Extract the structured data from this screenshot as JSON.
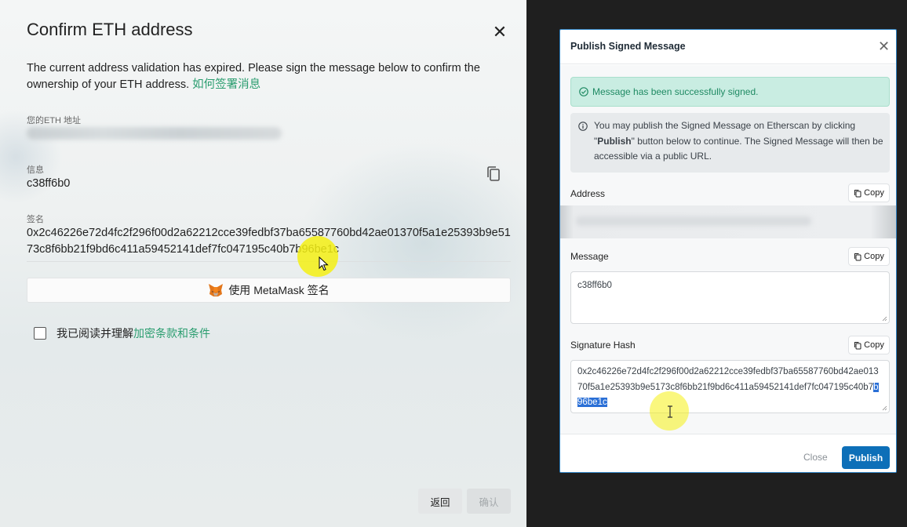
{
  "left_dialog": {
    "title": "Confirm ETH address",
    "close_symbol": "✕",
    "description": "The current address validation has expired. Please sign the message below to confirm the ownership of your ETH address.",
    "description_link": "如何签署消息",
    "address_label": "您的ETH 地址",
    "message_label": "信息",
    "message_value": "c38ff6b0",
    "signature_label": "签名",
    "signature_value": "0x2c46226e72d4fc2f296f00d2a62212cce39fedbf37ba65587760bd42ae01370f5a1e25393b9e5173c8f6bb21f9bd6c411a59452141def7fc047195c40b7b96be1c",
    "metamask_button": "使用 MetaMask 签名",
    "terms_prefix": "我已阅读并理解",
    "terms_link": "加密条款和条件",
    "back_button": "返回",
    "confirm_button": "确认"
  },
  "right_dialog": {
    "title": "Publish Signed Message",
    "close_symbol": "✕",
    "success_text": "Message has been successfully signed.",
    "info_pre": "You may publish the Signed Message on Etherscan by clicking \"",
    "info_bold": "Publish",
    "info_post": "\" button below to continue. The Signed Message will then be accessible via a public URL.",
    "address_label": "Address",
    "message_label": "Message",
    "message_value": "c38ff6b0",
    "signature_label": "Signature Hash",
    "signature_main": "0x2c46226e72d4fc2f296f00d2a62212cce39fedbf37ba65587760bd42ae01370f5a1e25393b9e5173c8f6bb21f9bd6c411a59452141def7fc047195c40b7",
    "signature_selected": "b96be1c",
    "copy_label": "Copy",
    "close_button": "Close",
    "publish_button": "Publish"
  },
  "colors": {
    "accent_green": "#2a9d6f",
    "publish_blue": "#0d6fb8",
    "success_bg": "#c9ede2",
    "cursor_highlight": "#f5f014"
  }
}
